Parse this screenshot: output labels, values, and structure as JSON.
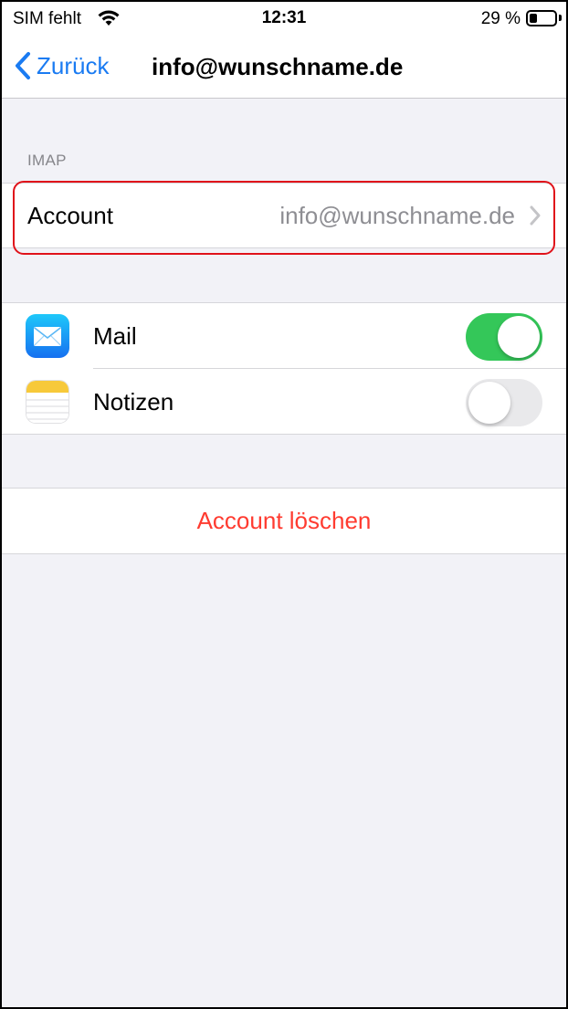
{
  "status_bar": {
    "carrier": "SIM fehlt",
    "time": "12:31",
    "battery_text": "29 %",
    "battery_level": 0.29,
    "wifi_icon": "wifi-icon",
    "battery_icon": "battery-icon"
  },
  "nav": {
    "back_label": "Zurück",
    "back_icon": "chevron-left-icon",
    "title": "info@wunschname.de"
  },
  "section_header": "IMAP",
  "account_row": {
    "label": "Account",
    "value": "info@wunschname.de",
    "chevron_icon": "chevron-right-icon"
  },
  "toggles": [
    {
      "label": "Mail",
      "icon": "mail-app-icon",
      "on": true
    },
    {
      "label": "Notizen",
      "icon": "notes-app-icon",
      "on": false
    }
  ],
  "delete_label": "Account löschen",
  "colors": {
    "accent": "#1a7bf2",
    "toggle_on": "#34c759",
    "destructive": "#ff3b30",
    "highlight": "#e0121a",
    "background": "#f2f2f7"
  }
}
